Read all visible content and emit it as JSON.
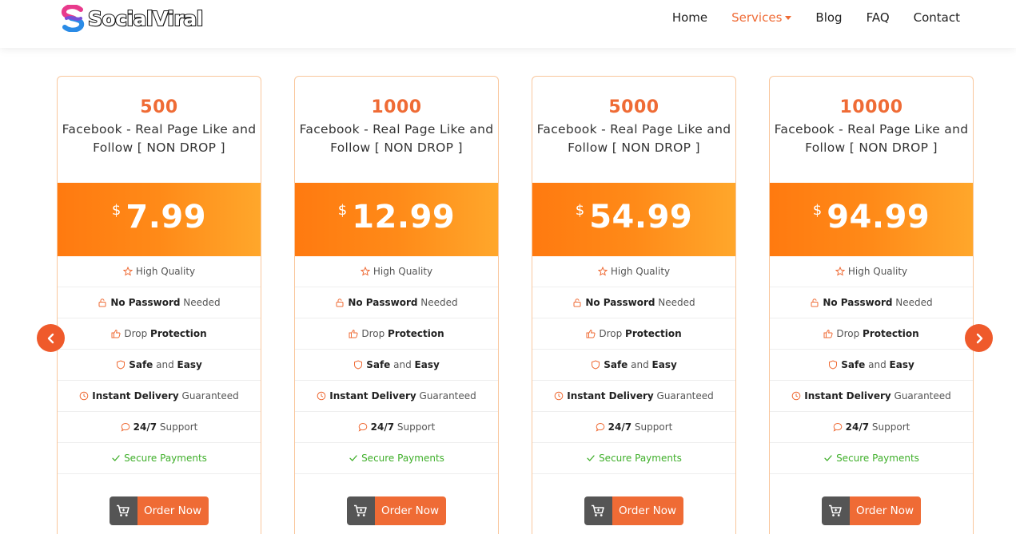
{
  "brand": {
    "name": "SocialViral"
  },
  "nav": {
    "items": [
      {
        "label": "Home",
        "active": false
      },
      {
        "label": "Services",
        "active": true,
        "dropdown": true
      },
      {
        "label": "Blog",
        "active": false
      },
      {
        "label": "FAQ",
        "active": false
      },
      {
        "label": "Contact",
        "active": false
      }
    ]
  },
  "colors": {
    "accent": "#ef6b35",
    "price_gradient_start": "#ff7a10",
    "price_gradient_end": "#ffa72b",
    "secure_green": "#3faf2a"
  },
  "features_template": [
    {
      "icon": "star-icon",
      "parts": [
        {
          "t": "High Quality",
          "b": false
        }
      ]
    },
    {
      "icon": "lock-icon",
      "parts": [
        {
          "t": "No Password",
          "b": true
        },
        {
          "t": " Needed",
          "b": false
        }
      ]
    },
    {
      "icon": "thumbs-up-icon",
      "parts": [
        {
          "t": "Drop ",
          "b": false
        },
        {
          "t": "Protection",
          "b": true
        }
      ]
    },
    {
      "icon": "shield-icon",
      "parts": [
        {
          "t": "Safe",
          "b": true
        },
        {
          "t": " and ",
          "b": false
        },
        {
          "t": "Easy",
          "b": true
        }
      ]
    },
    {
      "icon": "clock-icon",
      "parts": [
        {
          "t": "Instant Delivery",
          "b": true
        },
        {
          "t": " Guaranteed",
          "b": false
        }
      ]
    },
    {
      "icon": "chat-icon",
      "parts": [
        {
          "t": "24/7",
          "b": true
        },
        {
          "t": " Support",
          "b": false
        }
      ]
    },
    {
      "icon": "check-icon",
      "parts": [
        {
          "t": "Secure Payments",
          "b": false
        }
      ],
      "green": true
    }
  ],
  "cards": [
    {
      "qty": "500",
      "title": "Facebook - Real Page Like and Follow [ NON DROP ]",
      "currency": "$",
      "price": "7.99",
      "button": "Order Now"
    },
    {
      "qty": "1000",
      "title": "Facebook - Real Page Like and Follow [ NON DROP ]",
      "currency": "$",
      "price": "12.99",
      "button": "Order Now"
    },
    {
      "qty": "5000",
      "title": "Facebook - Real Page Like and Follow [ NON DROP ]",
      "currency": "$",
      "price": "54.99",
      "button": "Order Now"
    },
    {
      "qty": "10000",
      "title": "Facebook - Real Page Like and Follow [ NON DROP ]",
      "currency": "$",
      "price": "94.99",
      "button": "Order Now"
    }
  ]
}
